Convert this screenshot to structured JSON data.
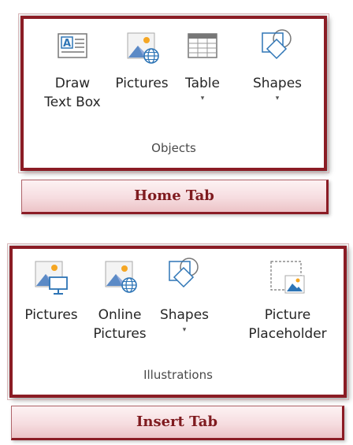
{
  "home_panel": {
    "items": [
      {
        "label": "Draw\nText Box",
        "icon": "text-box-icon"
      },
      {
        "label": "Pictures",
        "icon": "online-picture-icon"
      },
      {
        "label": "Table",
        "icon": "table-icon",
        "dropdown": true
      },
      {
        "label": "Shapes",
        "icon": "shapes-icon",
        "dropdown": true
      }
    ],
    "group_label": "Objects"
  },
  "home_banner": "Home Tab",
  "insert_panel": {
    "items": [
      {
        "label": "Pictures",
        "icon": "picture-monitor-icon"
      },
      {
        "label": "Online\nPictures",
        "icon": "online-picture-icon"
      },
      {
        "label": "Shapes",
        "icon": "shapes-icon",
        "dropdown": true
      },
      {
        "label": "Picture\nPlaceholder",
        "icon": "picture-placeholder-icon"
      }
    ],
    "group_label": "Illustrations"
  },
  "insert_banner": "Insert Tab",
  "dropdown_glyph": "▾",
  "colors": {
    "frame": "#8b1c25",
    "banner_text": "#7f1b1f",
    "icon_blue": "#2e75b6",
    "icon_orange": "#f5a623"
  }
}
